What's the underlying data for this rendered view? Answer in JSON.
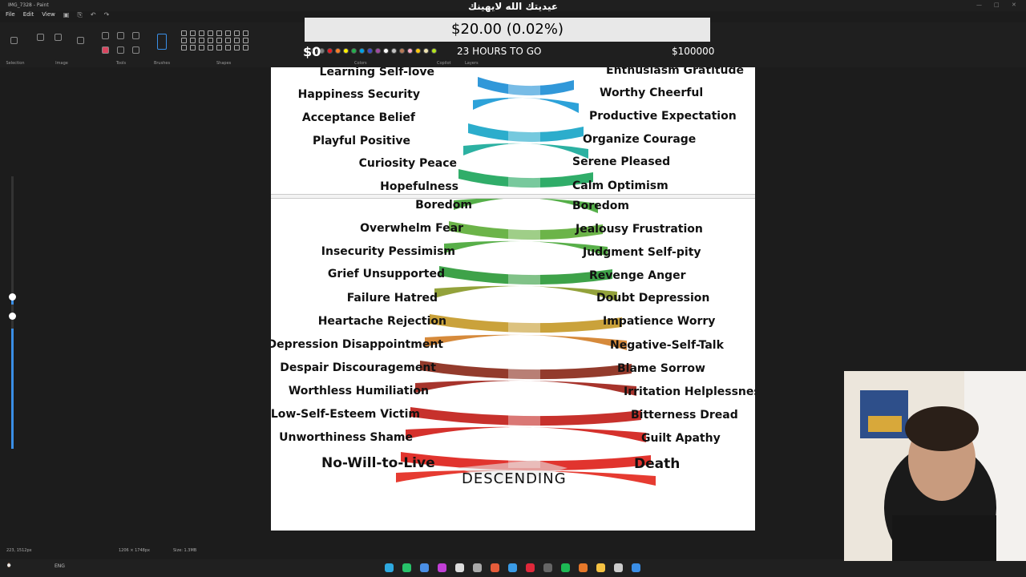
{
  "window": {
    "app_name": "IMG_7328 - Paint",
    "overlay_title": "عيديتك الله لايهينك",
    "controls": [
      "—",
      "□",
      "✕"
    ]
  },
  "menu": {
    "file": "File",
    "edit": "Edit",
    "view": "View"
  },
  "ribbon": {
    "groups": {
      "selection": "Selection",
      "image": "Image",
      "tools": "Tools",
      "brushes": "Brushes",
      "shapes": "Shapes",
      "colors": "Colors",
      "copilot": "Copilot",
      "layers": "Layers"
    },
    "swatch_colors": [
      "#000000",
      "#7f7f7f",
      "#ed1c24",
      "#ff7f27",
      "#fff200",
      "#22b14c",
      "#00a2e8",
      "#3f48cc",
      "#a349a4",
      "#ffffff",
      "#c3c3c3",
      "#b97a57",
      "#ffaec9",
      "#ffc90e",
      "#efe4b0",
      "#b5e61d"
    ]
  },
  "goal": {
    "amount": "$20.00 (0.02%)",
    "low": "$0",
    "time_left": "23 HOURS TO GO",
    "high": "$100000",
    "progress_percent": 0.02
  },
  "canvas": {
    "upper_left": [
      "Learning   Self-love",
      "Happiness   Security",
      "Acceptance   Belief",
      "Playful   Positive",
      "Curiosity  Peace",
      "Hopefulness"
    ],
    "upper_right": [
      "Enthusiasm   Gratitude",
      "Worthy  Cheerful",
      "Productive Expectation",
      "Organize  Courage",
      "Serene  Pleased",
      "Calm  Optimism"
    ],
    "lower_left": [
      "Boredom",
      "Overwhelm   Fear",
      "Insecurity  Pessimism",
      "Grief  Unsupported",
      "Failure  Hatred",
      "Heartache  Rejection",
      "Depression  Disappointment",
      "Despair   Discouragement",
      "Worthless   Humiliation",
      "Low-Self-Esteem  Victim",
      "Unworthiness    Shame"
    ],
    "lower_right": [
      "Boredom",
      "Jealousy  Frustration",
      "Judgment  Self-pity",
      "Revenge    Anger",
      "Doubt    Depression",
      "Impatience    Worry",
      "Negative-Self-Talk",
      "Blame    Sorrow",
      "Irritation  Helplessness",
      "Bitterness  Dread",
      "Guilt   Apathy"
    ],
    "bottom_left": "No-Will-to-Live",
    "bottom_right": "Death",
    "bottom_center": "DESCENDING"
  },
  "status": {
    "cursor": "223, 1512px",
    "canvas_size": "1206 × 1748px",
    "file_size": "Size: 1.3MB"
  },
  "taskbar": {
    "lang": "ENG",
    "icon_colors": [
      "#2ea9e0",
      "#27c26a",
      "#4a8fe6",
      "#c23fd6",
      "#dddddd",
      "#aaaaaa",
      "#e65c3a",
      "#3a9be6",
      "#e0283a",
      "#666666",
      "#1db954",
      "#e6782a",
      "#f5c242",
      "#cccccc",
      "#3a8ee6"
    ]
  }
}
